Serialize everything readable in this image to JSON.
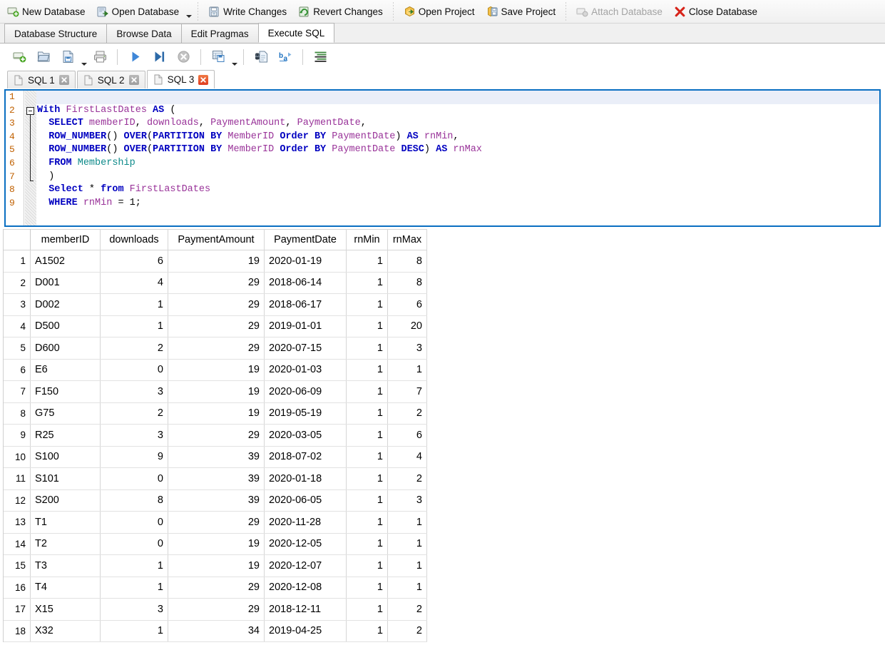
{
  "main_toolbar": {
    "buttons": [
      {
        "label": "New Database",
        "icon": "new-database-icon",
        "disabled": false
      },
      {
        "label": "Open Database",
        "icon": "open-database-icon",
        "disabled": false,
        "has_dropdown": true
      },
      {
        "label": "Write Changes",
        "icon": "write-changes-icon",
        "disabled": false
      },
      {
        "label": "Revert Changes",
        "icon": "revert-changes-icon",
        "disabled": false
      },
      {
        "label": "Open Project",
        "icon": "open-project-icon",
        "disabled": false
      },
      {
        "label": "Save Project",
        "icon": "save-project-icon",
        "disabled": false
      },
      {
        "label": "Attach Database",
        "icon": "attach-database-icon",
        "disabled": true
      },
      {
        "label": "Close Database",
        "icon": "close-database-icon",
        "disabled": false
      }
    ]
  },
  "view_tabs": {
    "items": [
      {
        "label": "Database Structure",
        "active": false
      },
      {
        "label": "Browse Data",
        "active": false
      },
      {
        "label": "Edit Pragmas",
        "active": false
      },
      {
        "label": "Execute SQL",
        "active": true
      }
    ]
  },
  "sql_toolbar": {
    "buttons": [
      {
        "name": "open-sql-tab-icon",
        "title": "Open tab"
      },
      {
        "name": "open-sql-file-icon",
        "title": "Open SQL file"
      },
      {
        "name": "save-sql-file-icon",
        "title": "Save SQL file",
        "has_dropdown": true
      },
      {
        "name": "print-icon",
        "title": "Print"
      },
      {
        "name": "execute-all-icon",
        "title": "Execute all"
      },
      {
        "name": "execute-current-line-icon",
        "title": "Execute current line"
      },
      {
        "name": "stop-icon",
        "title": "Stop"
      },
      {
        "name": "save-results-view-icon",
        "title": "Save results view",
        "has_dropdown": true
      },
      {
        "name": "find-replace-icon",
        "title": "Find and replace"
      },
      {
        "name": "toggle-word-wrap-icon",
        "title": "Word wrap"
      },
      {
        "name": "format-sql-icon",
        "title": "Format SQL"
      }
    ]
  },
  "sql_tabs": {
    "items": [
      {
        "label": "SQL 1",
        "active": false,
        "close_state": "grey"
      },
      {
        "label": "SQL 2",
        "active": false,
        "close_state": "grey"
      },
      {
        "label": "SQL 3",
        "active": true,
        "close_state": "red"
      }
    ]
  },
  "editor": {
    "focused": true,
    "current_line": 1,
    "line_numbers": [
      "1",
      "2",
      "3",
      "4",
      "5",
      "6",
      "7",
      "8",
      "9"
    ],
    "lines": [
      {
        "n": "1",
        "tokens": []
      },
      {
        "n": "2",
        "tokens": [
          {
            "t": "With",
            "c": "kw"
          },
          {
            "t": " ",
            "c": "pl"
          },
          {
            "t": "FirstLastDates",
            "c": "id"
          },
          {
            "t": " ",
            "c": "pl"
          },
          {
            "t": "AS",
            "c": "kw"
          },
          {
            "t": " (",
            "c": "pl"
          }
        ]
      },
      {
        "n": "3",
        "tokens": [
          {
            "t": "  ",
            "c": "pl"
          },
          {
            "t": "SELECT",
            "c": "kw"
          },
          {
            "t": " ",
            "c": "pl"
          },
          {
            "t": "memberID",
            "c": "id"
          },
          {
            "t": ", ",
            "c": "pl"
          },
          {
            "t": "downloads",
            "c": "id"
          },
          {
            "t": ", ",
            "c": "pl"
          },
          {
            "t": "PaymentAmount",
            "c": "id"
          },
          {
            "t": ", ",
            "c": "pl"
          },
          {
            "t": "PaymentDate",
            "c": "id"
          },
          {
            "t": ",",
            "c": "pl"
          }
        ]
      },
      {
        "n": "4",
        "tokens": [
          {
            "t": "  ",
            "c": "pl"
          },
          {
            "t": "ROW_NUMBER",
            "c": "kw"
          },
          {
            "t": "() ",
            "c": "pl"
          },
          {
            "t": "OVER",
            "c": "kw"
          },
          {
            "t": "(",
            "c": "pl"
          },
          {
            "t": "PARTITION",
            "c": "kw"
          },
          {
            "t": " ",
            "c": "pl"
          },
          {
            "t": "BY",
            "c": "kw"
          },
          {
            "t": " ",
            "c": "pl"
          },
          {
            "t": "MemberID",
            "c": "id"
          },
          {
            "t": " ",
            "c": "pl"
          },
          {
            "t": "Order",
            "c": "kw"
          },
          {
            "t": " ",
            "c": "pl"
          },
          {
            "t": "BY",
            "c": "kw"
          },
          {
            "t": " ",
            "c": "pl"
          },
          {
            "t": "PaymentDate",
            "c": "id"
          },
          {
            "t": ") ",
            "c": "pl"
          },
          {
            "t": "AS",
            "c": "kw"
          },
          {
            "t": " ",
            "c": "pl"
          },
          {
            "t": "rnMin",
            "c": "id"
          },
          {
            "t": ",",
            "c": "pl"
          }
        ]
      },
      {
        "n": "5",
        "tokens": [
          {
            "t": "  ",
            "c": "pl"
          },
          {
            "t": "ROW_NUMBER",
            "c": "kw"
          },
          {
            "t": "() ",
            "c": "pl"
          },
          {
            "t": "OVER",
            "c": "kw"
          },
          {
            "t": "(",
            "c": "pl"
          },
          {
            "t": "PARTITION",
            "c": "kw"
          },
          {
            "t": " ",
            "c": "pl"
          },
          {
            "t": "BY",
            "c": "kw"
          },
          {
            "t": " ",
            "c": "pl"
          },
          {
            "t": "MemberID",
            "c": "id"
          },
          {
            "t": " ",
            "c": "pl"
          },
          {
            "t": "Order",
            "c": "kw"
          },
          {
            "t": " ",
            "c": "pl"
          },
          {
            "t": "BY",
            "c": "kw"
          },
          {
            "t": " ",
            "c": "pl"
          },
          {
            "t": "PaymentDate",
            "c": "id"
          },
          {
            "t": " ",
            "c": "pl"
          },
          {
            "t": "DESC",
            "c": "kw"
          },
          {
            "t": ") ",
            "c": "pl"
          },
          {
            "t": "AS",
            "c": "kw"
          },
          {
            "t": " ",
            "c": "pl"
          },
          {
            "t": "rnMax",
            "c": "id"
          }
        ]
      },
      {
        "n": "6",
        "tokens": [
          {
            "t": "  ",
            "c": "pl"
          },
          {
            "t": "FROM",
            "c": "kw"
          },
          {
            "t": " ",
            "c": "pl"
          },
          {
            "t": "Membership",
            "c": "tbl"
          }
        ]
      },
      {
        "n": "7",
        "tokens": [
          {
            "t": "  )",
            "c": "pl"
          }
        ]
      },
      {
        "n": "8",
        "tokens": [
          {
            "t": "  ",
            "c": "pl"
          },
          {
            "t": "Select",
            "c": "kw"
          },
          {
            "t": " ",
            "c": "pl"
          },
          {
            "t": "*",
            "c": "pl"
          },
          {
            "t": " ",
            "c": "pl"
          },
          {
            "t": "from",
            "c": "kw"
          },
          {
            "t": " ",
            "c": "pl"
          },
          {
            "t": "FirstLastDates",
            "c": "id"
          }
        ]
      },
      {
        "n": "9",
        "tokens": [
          {
            "t": "  ",
            "c": "pl"
          },
          {
            "t": "WHERE",
            "c": "kw"
          },
          {
            "t": " ",
            "c": "pl"
          },
          {
            "t": "rnMin",
            "c": "id"
          },
          {
            "t": " = ",
            "c": "pl"
          },
          {
            "t": "1;",
            "c": "pl"
          }
        ]
      }
    ],
    "plain_text": "\nWith FirstLastDates AS (\n  SELECT memberID, downloads, PaymentAmount, PaymentDate,\n  ROW_NUMBER() OVER(PARTITION BY MemberID Order BY PaymentDate) AS rnMin,\n  ROW_NUMBER() OVER(PARTITION BY MemberID Order BY PaymentDate DESC) AS rnMax\n  FROM Membership\n  )\n  Select * from FirstLastDates\n  WHERE rnMin = 1;"
  },
  "results": {
    "columns": [
      "memberID",
      "downloads",
      "PaymentAmount",
      "PaymentDate",
      "rnMin",
      "rnMax"
    ],
    "rows": [
      {
        "n": "1",
        "memberID": "A1502",
        "downloads": "6",
        "PaymentAmount": "19",
        "PaymentDate": "2020-01-19",
        "rnMin": "1",
        "rnMax": "8"
      },
      {
        "n": "2",
        "memberID": "D001",
        "downloads": "4",
        "PaymentAmount": "29",
        "PaymentDate": "2018-06-14",
        "rnMin": "1",
        "rnMax": "8"
      },
      {
        "n": "3",
        "memberID": "D002",
        "downloads": "1",
        "PaymentAmount": "29",
        "PaymentDate": "2018-06-17",
        "rnMin": "1",
        "rnMax": "6"
      },
      {
        "n": "4",
        "memberID": "D500",
        "downloads": "1",
        "PaymentAmount": "29",
        "PaymentDate": "2019-01-01",
        "rnMin": "1",
        "rnMax": "20"
      },
      {
        "n": "5",
        "memberID": "D600",
        "downloads": "2",
        "PaymentAmount": "29",
        "PaymentDate": "2020-07-15",
        "rnMin": "1",
        "rnMax": "3"
      },
      {
        "n": "6",
        "memberID": "E6",
        "downloads": "0",
        "PaymentAmount": "19",
        "PaymentDate": "2020-01-03",
        "rnMin": "1",
        "rnMax": "1"
      },
      {
        "n": "7",
        "memberID": "F150",
        "downloads": "3",
        "PaymentAmount": "19",
        "PaymentDate": "2020-06-09",
        "rnMin": "1",
        "rnMax": "7"
      },
      {
        "n": "8",
        "memberID": "G75",
        "downloads": "2",
        "PaymentAmount": "19",
        "PaymentDate": "2019-05-19",
        "rnMin": "1",
        "rnMax": "2"
      },
      {
        "n": "9",
        "memberID": "R25",
        "downloads": "3",
        "PaymentAmount": "29",
        "PaymentDate": "2020-03-05",
        "rnMin": "1",
        "rnMax": "6"
      },
      {
        "n": "10",
        "memberID": "S100",
        "downloads": "9",
        "PaymentAmount": "39",
        "PaymentDate": "2018-07-02",
        "rnMin": "1",
        "rnMax": "4"
      },
      {
        "n": "11",
        "memberID": "S101",
        "downloads": "0",
        "PaymentAmount": "39",
        "PaymentDate": "2020-01-18",
        "rnMin": "1",
        "rnMax": "2"
      },
      {
        "n": "12",
        "memberID": "S200",
        "downloads": "8",
        "PaymentAmount": "39",
        "PaymentDate": "2020-06-05",
        "rnMin": "1",
        "rnMax": "3"
      },
      {
        "n": "13",
        "memberID": "T1",
        "downloads": "0",
        "PaymentAmount": "29",
        "PaymentDate": "2020-11-28",
        "rnMin": "1",
        "rnMax": "1"
      },
      {
        "n": "14",
        "memberID": "T2",
        "downloads": "0",
        "PaymentAmount": "19",
        "PaymentDate": "2020-12-05",
        "rnMin": "1",
        "rnMax": "1"
      },
      {
        "n": "15",
        "memberID": "T3",
        "downloads": "1",
        "PaymentAmount": "19",
        "PaymentDate": "2020-12-07",
        "rnMin": "1",
        "rnMax": "1"
      },
      {
        "n": "16",
        "memberID": "T4",
        "downloads": "1",
        "PaymentAmount": "29",
        "PaymentDate": "2020-12-08",
        "rnMin": "1",
        "rnMax": "1"
      },
      {
        "n": "17",
        "memberID": "X15",
        "downloads": "3",
        "PaymentAmount": "29",
        "PaymentDate": "2018-12-11",
        "rnMin": "1",
        "rnMax": "2"
      },
      {
        "n": "18",
        "memberID": "X32",
        "downloads": "1",
        "PaymentAmount": "34",
        "PaymentDate": "2019-04-25",
        "rnMin": "1",
        "rnMax": "2"
      }
    ]
  },
  "colors": {
    "editor_focus_border": "#0a6fc2",
    "keyword": "#0000c0",
    "identifier": "#993399",
    "table_name": "#0d8a8a",
    "line_number": "#c06000",
    "close_tab_active": "#de3c20",
    "current_line_highlight": "#eaeef8"
  }
}
